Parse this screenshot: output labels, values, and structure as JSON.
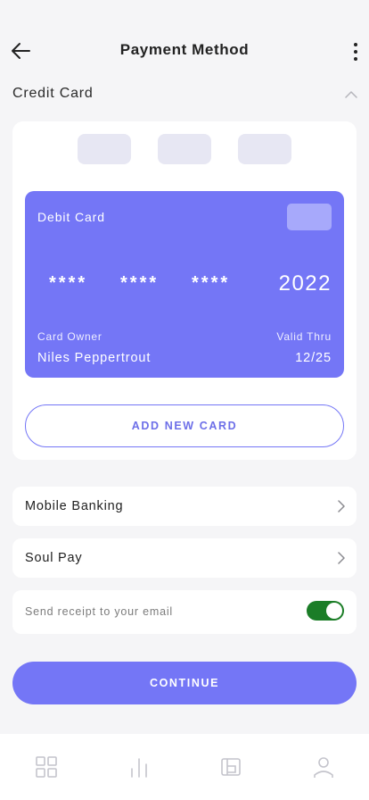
{
  "header": {
    "title": "Payment Method",
    "back_icon": "arrow-left-icon",
    "more_icon": "more-vertical-icon"
  },
  "credit_card_section": {
    "title": "Credit Card",
    "collapse_icon": "chevron-up-icon",
    "card": {
      "type_label": "Debit Card",
      "number_groups": [
        "****",
        "****",
        "****"
      ],
      "number_last": "2022",
      "owner_label": "Card Owner",
      "owner_name": "Niles Peppertrout",
      "valid_label": "Valid Thru",
      "valid_value": "12/25"
    },
    "add_card_label": "ADD NEW CARD"
  },
  "payment_options": [
    {
      "label": "Mobile Banking",
      "icon": "chevron-right-icon"
    },
    {
      "label": "Soul Pay",
      "icon": "chevron-right-icon"
    }
  ],
  "receipt": {
    "label": "Send receipt to your email",
    "enabled": true
  },
  "continue_label": "CONTINUE",
  "bottom_nav": [
    {
      "icon": "grid-icon"
    },
    {
      "icon": "bar-chart-icon"
    },
    {
      "icon": "wallet-icon"
    },
    {
      "icon": "user-icon"
    }
  ],
  "colors": {
    "accent": "#7476f6",
    "accent_light": "#a7a9fb",
    "tab_placeholder": "#e7e7f3",
    "toggle_on": "#1b7d27",
    "background": "#f5f5f7"
  }
}
